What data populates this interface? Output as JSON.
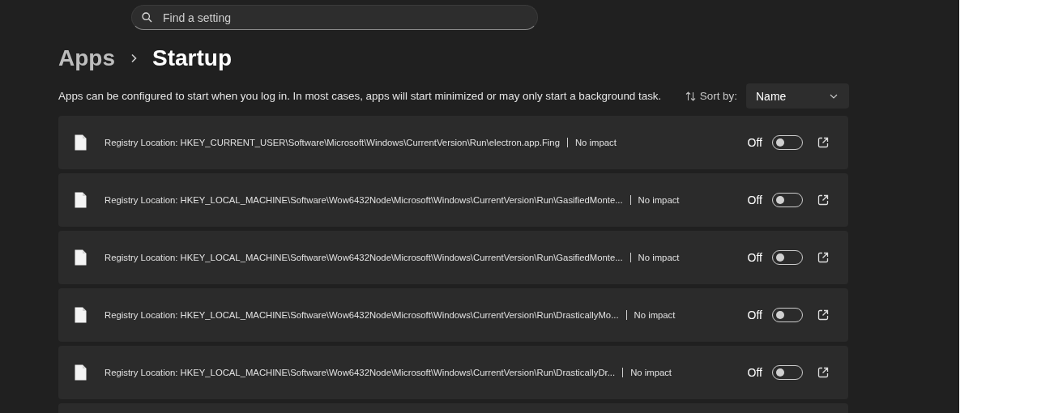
{
  "search": {
    "placeholder": "Find a setting"
  },
  "breadcrumb": [
    {
      "label": "Apps",
      "current": false
    },
    {
      "label": "Startup",
      "current": true
    }
  ],
  "description": "Apps can be configured to start when you log in. In most cases, apps will start minimized or may only start a background task.",
  "sort": {
    "label": "Sort by:",
    "value": "Name"
  },
  "apps": [
    {
      "location": "Registry Location:  HKEY_CURRENT_USER\\Software\\Microsoft\\Windows\\CurrentVersion\\Run\\electron.app.Fing",
      "impact": "No impact",
      "state_label": "Off",
      "on": false
    },
    {
      "location": "Registry Location:  HKEY_LOCAL_MACHINE\\Software\\Wow6432Node\\Microsoft\\Windows\\CurrentVersion\\Run\\GasifiedMonte...",
      "impact": "No impact",
      "state_label": "Off",
      "on": false
    },
    {
      "location": "Registry Location:  HKEY_LOCAL_MACHINE\\Software\\Wow6432Node\\Microsoft\\Windows\\CurrentVersion\\Run\\GasifiedMonte...",
      "impact": "No impact",
      "state_label": "Off",
      "on": false
    },
    {
      "location": "Registry Location:  HKEY_LOCAL_MACHINE\\Software\\Wow6432Node\\Microsoft\\Windows\\CurrentVersion\\Run\\DrasticallyMo...",
      "impact": "No impact",
      "state_label": "Off",
      "on": false
    },
    {
      "location": "Registry Location:  HKEY_LOCAL_MACHINE\\Software\\Wow6432Node\\Microsoft\\Windows\\CurrentVersion\\Run\\DrasticallyDr...",
      "impact": "No impact",
      "state_label": "Off",
      "on": false
    }
  ]
}
